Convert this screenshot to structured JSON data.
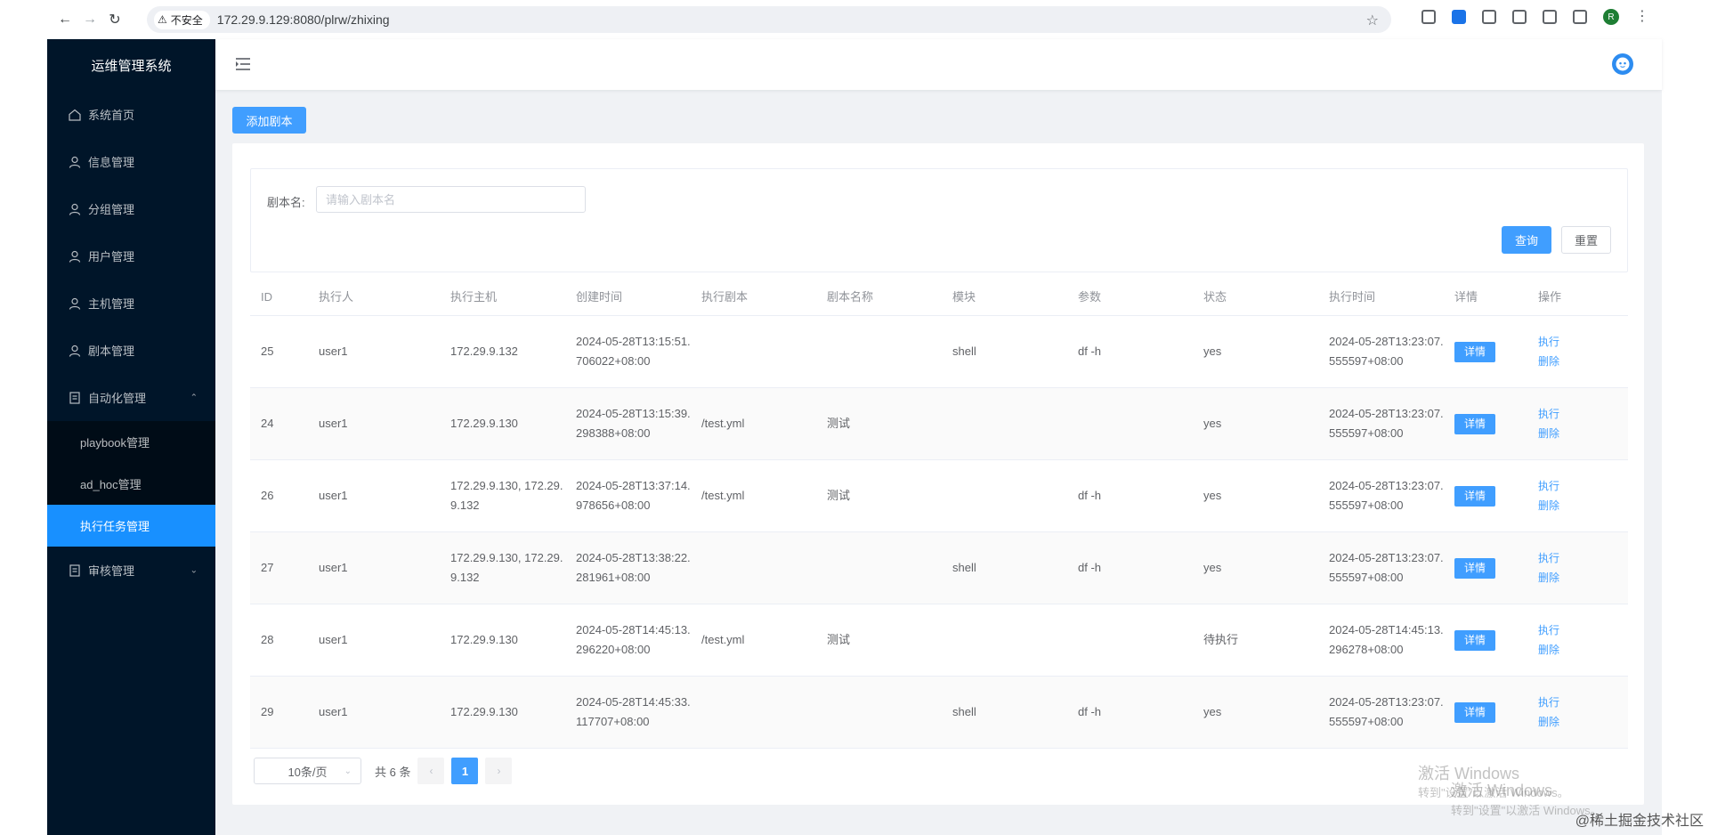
{
  "browser": {
    "security_label": "不安全",
    "url": "172.29.9.129:8080/plrw/zhixing",
    "profile_initial": "R"
  },
  "sidebar": {
    "title": "运维管理系统",
    "items": [
      {
        "label": "系统首页",
        "icon": "home-icon"
      },
      {
        "label": "信息管理",
        "icon": "user-icon"
      },
      {
        "label": "分组管理",
        "icon": "user-icon"
      },
      {
        "label": "用户管理",
        "icon": "user-icon"
      },
      {
        "label": "主机管理",
        "icon": "user-icon"
      },
      {
        "label": "剧本管理",
        "icon": "user-icon"
      },
      {
        "label": "自动化管理",
        "icon": "document-icon",
        "expanded": true
      },
      {
        "label": "审核管理",
        "icon": "document-icon",
        "expanded": false
      }
    ],
    "submenu": [
      {
        "label": "playbook管理"
      },
      {
        "label": "ad_hoc管理"
      },
      {
        "label": "执行任务管理",
        "active": true
      }
    ]
  },
  "toolbar": {
    "add_label": "添加剧本"
  },
  "search": {
    "label": "剧本名:",
    "placeholder": "请输入剧本名",
    "query_label": "查询",
    "reset_label": "重置"
  },
  "table": {
    "headers": [
      "ID",
      "执行人",
      "执行主机",
      "创建时间",
      "执行剧本",
      "剧本名称",
      "模块",
      "参数",
      "状态",
      "执行时间",
      "详情",
      "操作"
    ],
    "detail_label": "详情",
    "exec_label": "执行",
    "delete_label": "删除",
    "rows": [
      {
        "id": "25",
        "user": "user1",
        "host": "172.29.9.132",
        "ctime": "2024-05-28T13:15:51.706022+08:00",
        "script": "",
        "name": "",
        "module": "shell",
        "args": "df -h",
        "status": "yes",
        "etime": "2024-05-28T13:23:07.555597+08:00"
      },
      {
        "id": "24",
        "user": "user1",
        "host": "172.29.9.130",
        "ctime": "2024-05-28T13:15:39.298388+08:00",
        "script": "/test.yml",
        "name": "测试",
        "module": "",
        "args": "",
        "status": "yes",
        "etime": "2024-05-28T13:23:07.555597+08:00"
      },
      {
        "id": "26",
        "user": "user1",
        "host": "172.29.9.130, 172.29.9.132",
        "ctime": "2024-05-28T13:37:14.978656+08:00",
        "script": "/test.yml",
        "name": "测试",
        "module": "",
        "args": "df -h",
        "status": "yes",
        "etime": "2024-05-28T13:23:07.555597+08:00"
      },
      {
        "id": "27",
        "user": "user1",
        "host": "172.29.9.130, 172.29.9.132",
        "ctime": "2024-05-28T13:38:22.281961+08:00",
        "script": "",
        "name": "",
        "module": "shell",
        "args": "df -h",
        "status": "yes",
        "etime": "2024-05-28T13:23:07.555597+08:00"
      },
      {
        "id": "28",
        "user": "user1",
        "host": "172.29.9.130",
        "ctime": "2024-05-28T14:45:13.296220+08:00",
        "script": "/test.yml",
        "name": "测试",
        "module": "",
        "args": "",
        "status": "待执行",
        "etime": "2024-05-28T14:45:13.296278+08:00"
      },
      {
        "id": "29",
        "user": "user1",
        "host": "172.29.9.130",
        "ctime": "2024-05-28T14:45:33.117707+08:00",
        "script": "",
        "name": "",
        "module": "shell",
        "args": "df -h",
        "status": "yes",
        "etime": "2024-05-28T13:23:07.555597+08:00"
      }
    ]
  },
  "pagination": {
    "page_size": "10条/页",
    "total": "共 6 条",
    "current_page": "1"
  },
  "watermark": {
    "line1": "激活 Windows",
    "line2": "转到\"设置\"以激活 Windows。",
    "line3": "激活 Windows",
    "line4": "转到\"设置\"以激活 Windows。",
    "credit": "@稀土掘金技术社区"
  }
}
